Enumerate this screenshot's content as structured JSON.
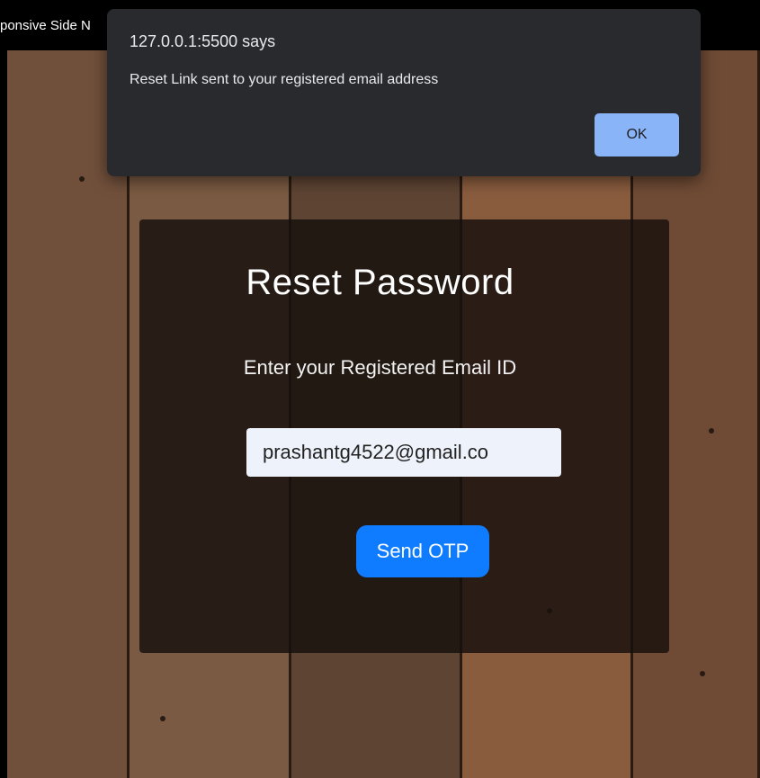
{
  "browser": {
    "tab_title": "ponsive Side N"
  },
  "reset_form": {
    "title": "Reset Password",
    "subtitle": "Enter your Registered Email ID",
    "email_value": "prashantg4522@gmail.co",
    "send_button_label": "Send OTP"
  },
  "alert_dialog": {
    "origin": "127.0.0.1:5500 says",
    "message": "Reset Link sent to your registered email address",
    "ok_label": "OK"
  },
  "colors": {
    "dialog_bg": "#292a2d",
    "ok_button": "#8ab4f8",
    "send_button": "#0f7cff",
    "panel_bg": "rgba(22,16,12,0.82)"
  }
}
